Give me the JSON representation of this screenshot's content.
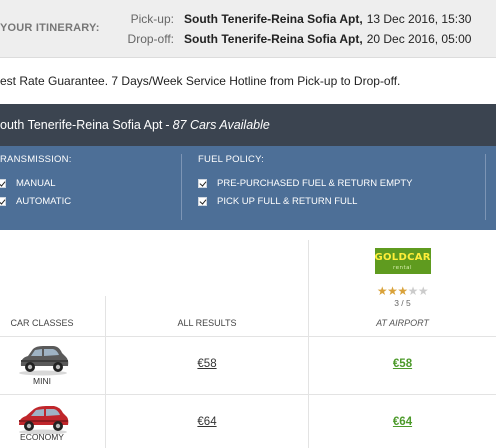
{
  "itinerary": {
    "title": "YOUR ITINERARY:",
    "pickup": {
      "label": "Pick-up:",
      "location": "South Tenerife-Reina Sofia Apt,",
      "datetime": "13 Dec 2016, 15:30"
    },
    "dropoff": {
      "label": "Drop-off:",
      "location": "South Tenerife-Reina Sofia Apt,",
      "datetime": "20 Dec 2016, 05:00"
    }
  },
  "guarantee": "est Rate Guarantee. 7 Days/Week Service Hotline from Pick-up to Drop-off.",
  "location_bar": {
    "name": "outh Tenerife-Reina Sofia Apt",
    "separator": "-",
    "count": "87 Cars Available"
  },
  "filters": {
    "transmission": {
      "heading": "RANSMISSION:",
      "options": [
        {
          "label": "MANUAL",
          "checked": true
        },
        {
          "label": "AUTOMATIC",
          "checked": true
        }
      ]
    },
    "fuel_policy": {
      "heading": "FUEL POLICY:",
      "options": [
        {
          "label": "PRE-PURCHASED FUEL & RETURN EMPTY",
          "checked": true
        },
        {
          "label": "PICK UP FULL & RETURN FULL",
          "checked": true
        }
      ]
    }
  },
  "table": {
    "headers": {
      "classes": "CAR CLASSES",
      "all": "ALL RESULTS",
      "airport": "AT AIRPORT"
    },
    "supplier": {
      "logo_text": "GOLDCAR",
      "logo_sub": "rental",
      "logo_color": "#5f9b1f",
      "stars": 3,
      "stars_max": 5,
      "rating_text": "3 / 5"
    },
    "rows": [
      {
        "car_class": "MINI",
        "car_color": "#5a5a5a",
        "all_price": "€58",
        "airport_price": "€58"
      },
      {
        "car_class": "ECONOMY",
        "car_color": "#c0262b",
        "all_price": "€64",
        "airport_price": "€64"
      }
    ]
  },
  "colors": {
    "itinerary_bg": "#eeeeee",
    "location_bar_bg": "#3b4450",
    "filter_bg": "#4d6f97",
    "price_green": "#4c9a2a"
  }
}
